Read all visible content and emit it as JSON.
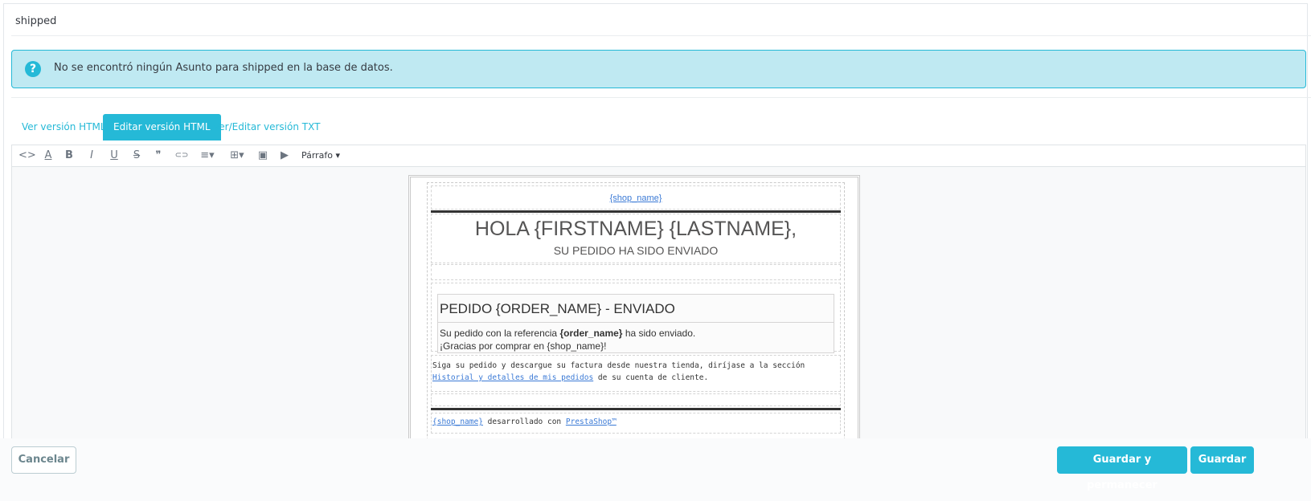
{
  "header": {
    "title": "shipped"
  },
  "alert": {
    "icon": "question-circle-icon",
    "icon_glyph": "?",
    "text": "No se encontró ningún Asunto para shipped en la base de datos."
  },
  "tabs": [
    {
      "label": "Ver versión HTML",
      "active": false
    },
    {
      "label": "Editar versión HTML",
      "active": true
    },
    {
      "label": "Ver/Editar versión TXT",
      "active": false
    }
  ],
  "toolbar": {
    "code_glyph": "<>",
    "color_glyph": "A",
    "bold_glyph": "B",
    "italic_glyph": "I",
    "underline_glyph": "U",
    "strike_glyph": "S",
    "quote_glyph": "❞",
    "link_glyph": "⊂⊃",
    "align_glyph": "≡▾",
    "table_glyph": "⊞▾",
    "image_glyph": "▣",
    "video_glyph": "▶",
    "format_label": "Párrafo ▾"
  },
  "email": {
    "logo_link": "{shop_name}",
    "greeting": "HOLA {FIRSTNAME} {LASTNAME},",
    "subtitle": "SU PEDIDO HA SIDO ENVIADO",
    "order_title": "PEDIDO {ORDER_NAME} - ENVIADO",
    "order_line1_pre": "Su pedido con la referencia ",
    "order_line1_bold": "{order_name}",
    "order_line1_post": " ha sido enviado.",
    "order_line2": "¡Gracias por comprar en {shop_name}!",
    "follow_pre": "Siga su pedido y descargue su factura desde nuestra tienda, diríjase a la sección ",
    "follow_link": "Historial y detalles de mis pedidos",
    "follow_post": " de su cuenta de cliente.",
    "footer_shop_link": "{shop_name}",
    "footer_text": " desarrollado con ",
    "footer_brand_link": "PrestaShop™"
  },
  "buttons": {
    "cancel": "Cancelar",
    "save_stay": "Guardar y permanecer",
    "save": "Guardar"
  },
  "colors": {
    "accent": "#25b9d7",
    "alert_bg": "#bfe9f2",
    "link": "#3b7ad6"
  }
}
